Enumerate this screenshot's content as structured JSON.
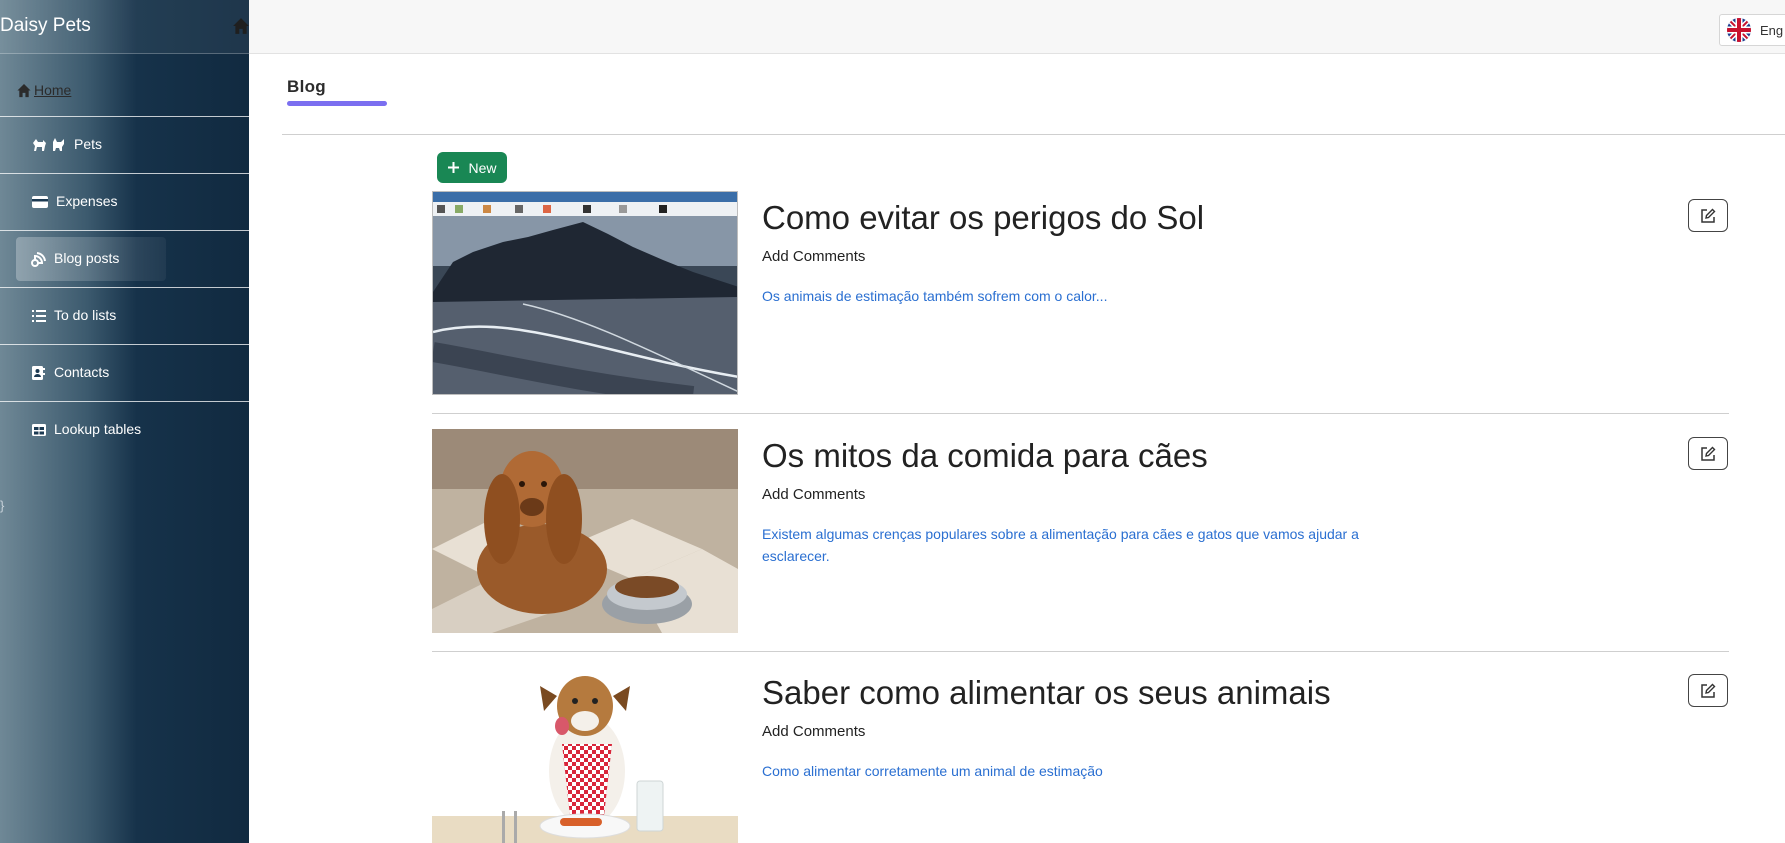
{
  "sidebar": {
    "brand": "Daisy Pets",
    "home_label": "Home",
    "items": [
      {
        "label": "Pets",
        "icon": "pets-icon"
      },
      {
        "label": "Expenses",
        "icon": "credit-card-icon"
      },
      {
        "label": "Blog posts",
        "icon": "blog-icon"
      },
      {
        "label": "To do lists",
        "icon": "list-icon"
      },
      {
        "label": "Contacts",
        "icon": "contact-book-icon"
      },
      {
        "label": "Lookup tables",
        "icon": "table-icon"
      }
    ],
    "active_item": "Blog posts",
    "stray_text": "}"
  },
  "topbar": {
    "language_label": "Eng",
    "language_icon": "uk-flag-icon"
  },
  "main": {
    "page_title": "Blog",
    "new_button_label": "New",
    "accent_color": "#7b6ff0",
    "new_button_color": "#198754",
    "posts": [
      {
        "title": "Como evitar os perigos do Sol",
        "comments_label": "Add Comments",
        "excerpt": "Os animais de estimação também sofrem com o calor...",
        "image": "beach-mountain-screenshot"
      },
      {
        "title": "Os mitos da comida para cães",
        "comments_label": "Add Comments",
        "excerpt": "Existem algumas crenças populares sobre a alimentação para cães e gatos que vamos ajudar a esclarecer.",
        "image": "spaniel-with-food-bowl"
      },
      {
        "title": "Saber como alimentar os seus animais",
        "comments_label": "Add Comments",
        "excerpt": "Como alimentar corretamente um animal de estimação",
        "image": "dog-with-bib-at-table"
      }
    ]
  }
}
